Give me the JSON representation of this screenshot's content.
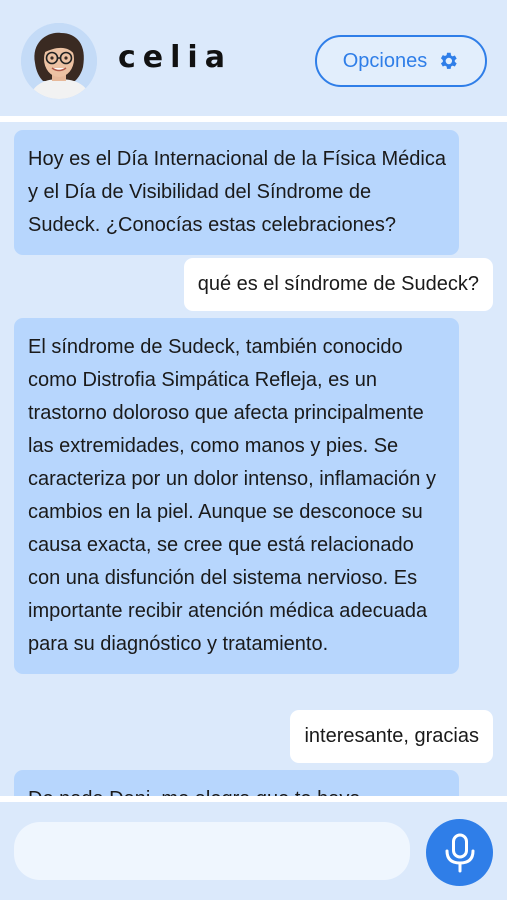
{
  "header": {
    "bot_name": "celia",
    "options_label": "Opciones",
    "options_icon": "gear-icon",
    "avatar_icon": "avatar-woman-glasses"
  },
  "messages": [
    {
      "role": "bot",
      "text": "Hoy es el Día Internacional de la Física Médica y el Día de Visibilidad del Síndrome de Sudeck. ¿Conocías estas celebraciones?"
    },
    {
      "role": "user",
      "text": "qué es el síndrome de Sudeck?"
    },
    {
      "role": "bot",
      "text": "El síndrome de Sudeck, también conocido como Distrofia Simpática Refleja, es un trastorno doloroso que afecta principalmente las extremidades, como manos y pies. Se caracteriza por un dolor intenso, inflamación y cambios en la piel. Aunque se desconoce su causa exacta, se cree que está relacionado con una disfunción del sistema nervioso. Es importante recibir atención médica adecuada para su diagnóstico y tratamiento."
    },
    {
      "role": "user",
      "text": "interesante, gracias"
    },
    {
      "role": "bot",
      "text": "De nada Dani, me alegra que te haya"
    }
  ],
  "input": {
    "value": "",
    "placeholder": ""
  },
  "footer": {
    "mic_icon": "microphone-icon"
  },
  "colors": {
    "accent": "#2f7ee8",
    "bot_bubble": "#b7d6fd",
    "user_bubble": "#ffffff",
    "background": "#dbe9fb"
  }
}
